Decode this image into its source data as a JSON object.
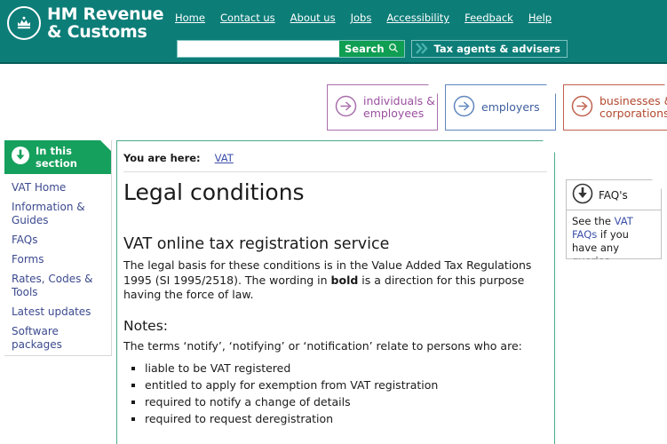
{
  "header": {
    "logo": {
      "icon": "crown-emblem-icon",
      "line1": "HM Revenue",
      "line2": "& Customs"
    },
    "nav_links": [
      {
        "label": "Home"
      },
      {
        "label": "Contact us"
      },
      {
        "label": "About us"
      },
      {
        "label": "Jobs"
      },
      {
        "label": "Accessibility"
      },
      {
        "label": "Feedback"
      },
      {
        "label": "Help"
      }
    ],
    "search": {
      "value": "",
      "placeholder": "",
      "button_label": "Search",
      "button_icon": "magnifier-icon"
    },
    "tax_agents": {
      "label": "Tax agents & advisers",
      "icon": "double-chevron-right-icon"
    },
    "background_color": "#0d7d78"
  },
  "audiences": [
    {
      "line1": "individuals &",
      "line2": "employees",
      "icon": "circle-arrow-right-icon",
      "color": "#9b4fa0"
    },
    {
      "line1": "employers",
      "line2": "",
      "icon": "circle-arrow-right-icon",
      "color": "#3f5f9e"
    },
    {
      "line1": "businesses &",
      "line2": "corporations",
      "icon": "circle-arrow-right-icon",
      "color": "#b2492f"
    }
  ],
  "sidebar": {
    "header_label": "In this section",
    "header_icon": "circle-arrow-down-icon",
    "header_color": "#16a05d",
    "items": [
      {
        "label": "VAT Home"
      },
      {
        "label": "Information & Guides"
      },
      {
        "label": "FAQs"
      },
      {
        "label": "Forms"
      },
      {
        "label": "Rates, Codes & Tools"
      },
      {
        "label": "Latest updates"
      },
      {
        "label": "Software packages"
      }
    ]
  },
  "main": {
    "breadcrumb_label": "You are here:",
    "breadcrumb_link": "VAT",
    "page_title": "Legal conditions",
    "section_title": "VAT online tax registration service",
    "intro_before_bold": "The legal basis for these conditions is in the Value Added Tax Regulations 1995 (SI 1995/2518). The wording in ",
    "intro_bold": "bold",
    "intro_after_bold": " is a direction for this purpose having the force of law.",
    "notes_title": "Notes:",
    "notes_intro": "The terms ‘notify’, ‘notifying’ or ‘notification’ relate to persons who are:",
    "notes_items": [
      {
        "label": "liable to be VAT registered"
      },
      {
        "label": "entitled to apply for exemption from VAT registration"
      },
      {
        "label": "required to notify a change of details"
      },
      {
        "label": "required to request deregistration"
      }
    ]
  },
  "faq": {
    "title": "FAQ's",
    "icon": "circle-arrow-down-icon",
    "text_before_link": "See the ",
    "link_label": "VAT FAQs",
    "text_after_link": " if you have any queries."
  }
}
